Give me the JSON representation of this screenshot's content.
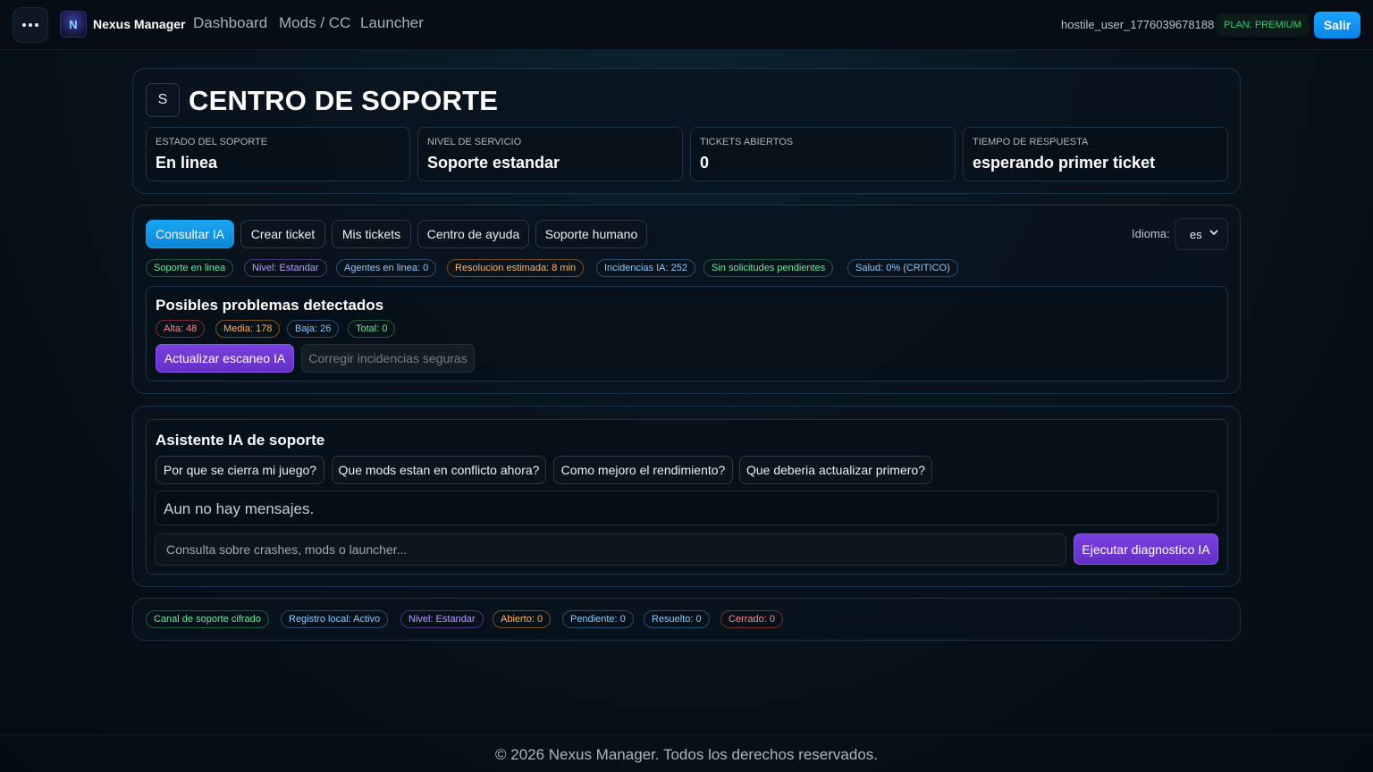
{
  "topbar": {
    "brand": "Nexus Manager",
    "nav": [
      "Dashboard",
      "Mods / CC",
      "Launcher"
    ],
    "username": "hostile_user_1776039678188",
    "plan": "PLAN: PREMIUM",
    "logout": "Salir"
  },
  "header": {
    "icon_letter": "S",
    "title": "CENTRO DE SOPORTE",
    "stats": [
      {
        "label": "ESTADO DEL SOPORTE",
        "value": "En linea"
      },
      {
        "label": "NIVEL DE SERVICIO",
        "value": "Soporte estandar"
      },
      {
        "label": "TICKETS ABIERTOS",
        "value": "0"
      },
      {
        "label": "TIEMPO DE RESPUESTA",
        "value": "esperando primer ticket"
      }
    ]
  },
  "tabs": {
    "items": [
      "Consultar IA",
      "Crear ticket",
      "Mis tickets",
      "Centro de ayuda",
      "Soporte humano"
    ],
    "language_label": "Idioma:",
    "language_value": "es"
  },
  "status_tags": [
    "Soporte en linea",
    "Nivel: Estandar",
    "Agentes en linea: 0",
    "Resolucion estimada: 8 min",
    "Incidencias IA: 252",
    "Sin solicitudes pendientes",
    "Salud: 0% (CRITICO)"
  ],
  "problems": {
    "title": "Posibles problemas detectados",
    "counts": [
      "Alta: 48",
      "Media: 178",
      "Baja: 26",
      "Total: 0"
    ],
    "refresh_button": "Actualizar escaneo IA",
    "fix_button": "Corregir incidencias seguras"
  },
  "assistant": {
    "title": "Asistente IA de soporte",
    "suggestions": [
      "Por que se cierra mi juego?",
      "Que mods estan en conflicto ahora?",
      "Como mejoro el rendimiento?",
      "Que deberia actualizar primero?"
    ],
    "empty_message": "Aun no hay mensajes.",
    "input_placeholder": "Consulta sobre crashes, mods o launcher...",
    "run_button": "Ejecutar diagnostico IA"
  },
  "footer_tags": [
    "Canal de soporte cifrado",
    "Registro local: Activo",
    "Nivel: Estandar",
    "Abierto: 0",
    "Pendiente: 0",
    "Resuelto: 0",
    "Cerrado: 0"
  ],
  "footer": "© 2026 Nexus Manager. Todos los derechos reservados.",
  "colors": {
    "accent_blue": "#1aa3ff",
    "accent_purple": "#7a3fe0",
    "plan_green": "#2ecc71",
    "background": "#08141d"
  }
}
